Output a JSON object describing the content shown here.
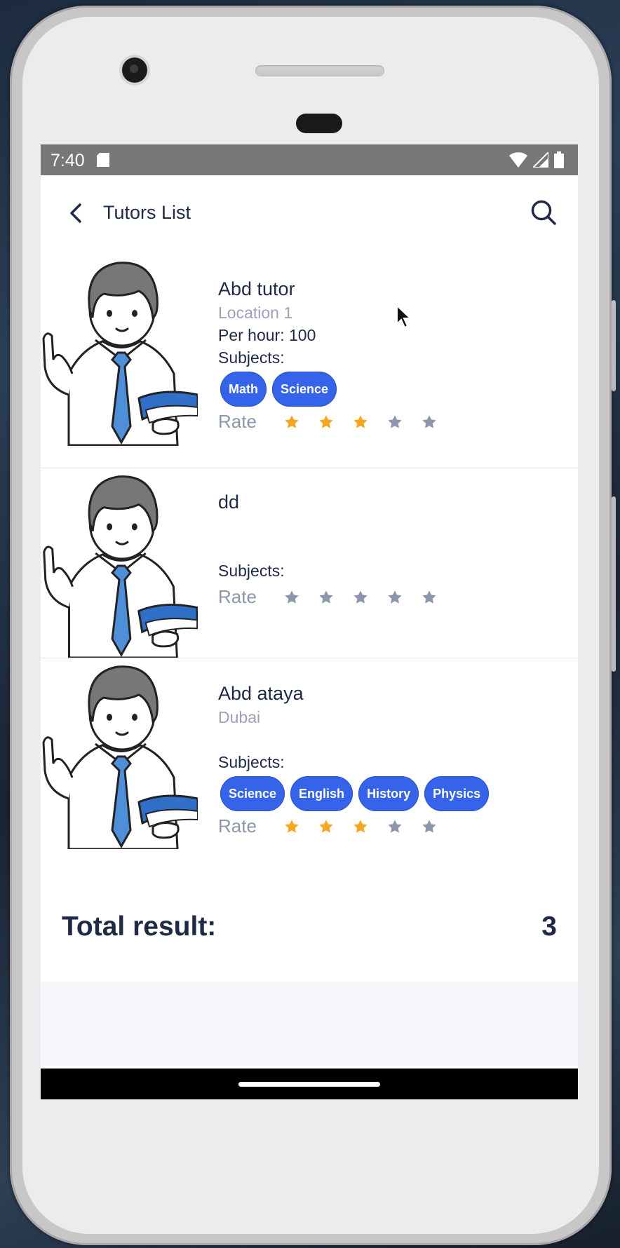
{
  "status_bar": {
    "time": "7:40"
  },
  "app_bar": {
    "title": "Tutors List"
  },
  "labels": {
    "subjects": "Subjects:",
    "rate": "Rate"
  },
  "tutors": [
    {
      "name": "Abd tutor",
      "location": "Location 1",
      "per_hour": "Per hour: 100",
      "subjects": [
        "Math",
        "Science"
      ],
      "rating": 3
    },
    {
      "name": "dd",
      "location": "",
      "per_hour": "",
      "subjects": [],
      "rating": 0
    },
    {
      "name": "Abd ataya",
      "location": "Dubai",
      "per_hour": "",
      "subjects": [
        "Science",
        "English",
        "History",
        "Physics"
      ],
      "rating": 3
    }
  ],
  "total": {
    "label": "Total result:",
    "value": "3"
  },
  "colors": {
    "chip": "#3563e9",
    "star_on": "#f5a623",
    "star_off": "#8d96ad",
    "title": "#1f2a44"
  }
}
